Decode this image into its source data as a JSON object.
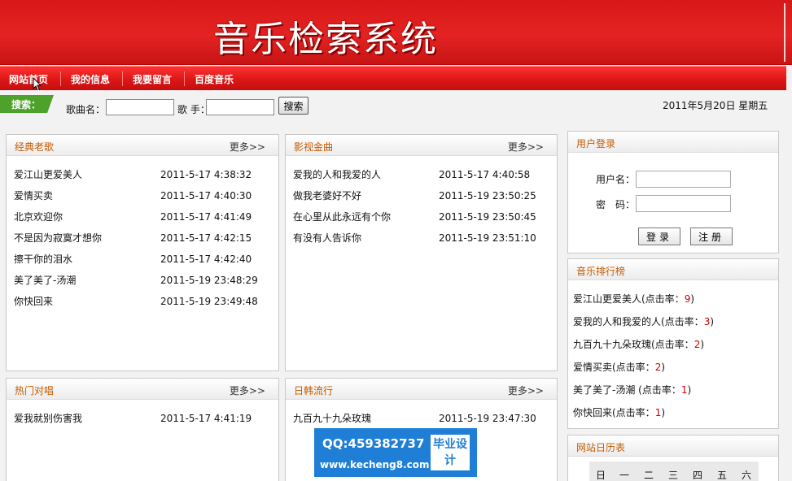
{
  "banner": {
    "title": "音乐检索系统"
  },
  "nav": [
    "网站首页",
    "我的信息",
    "我要留言",
    "百度音乐"
  ],
  "search": {
    "tag": "搜索：",
    "song_label": "歌曲名：",
    "song_value": "",
    "singer_label": "歌  手：",
    "singer_value": "",
    "button": "搜索",
    "date": "2011年5月20日  星期五"
  },
  "panels": {
    "classic": {
      "title": "经典老歌",
      "more": "更多>>",
      "rows": [
        {
          "name": "爱江山更爱美人",
          "time": "2011-5-17 4:38:32"
        },
        {
          "name": "爱情买卖",
          "time": "2011-5-17 4:40:30"
        },
        {
          "name": "北京欢迎你",
          "time": "2011-5-17 4:41:49"
        },
        {
          "name": "不是因为寂寞才想你",
          "time": "2011-5-17 4:42:15"
        },
        {
          "name": "擦干你的泪水",
          "time": "2011-5-17 4:42:40"
        },
        {
          "name": "美了美了-汤潮",
          "time": "2011-5-19 23:48:29"
        },
        {
          "name": "你快回来",
          "time": "2011-5-19 23:49:48"
        }
      ]
    },
    "film": {
      "title": "影视金曲",
      "more": "更多>>",
      "rows": [
        {
          "name": "爱我的人和我爱的人",
          "time": "2011-5-17 4:40:58"
        },
        {
          "name": "做我老婆好不好",
          "time": "2011-5-19 23:50:25"
        },
        {
          "name": "在心里从此永远有个你",
          "time": "2011-5-19 23:50:45"
        },
        {
          "name": "有没有人告诉你",
          "time": "2011-5-19 23:51:10"
        }
      ]
    },
    "duet": {
      "title": "热门对唱",
      "more": "更多>>",
      "rows": [
        {
          "name": "爱我就别伤害我",
          "time": "2011-5-17 4:41:19"
        }
      ]
    },
    "jk": {
      "title": "日韩流行",
      "more": "更多>>",
      "rows": [
        {
          "name": "九百九十九朵玫瑰",
          "time": "2011-5-19 23:47:30"
        }
      ]
    }
  },
  "login": {
    "title": "用户登录",
    "user_label": "用户名：",
    "pass_label": "密　码：",
    "login_btn": "登录",
    "register_btn": "注册"
  },
  "rank": {
    "title": "音乐排行榜",
    "items": [
      {
        "name": "爱江山更爱美人(点击率：",
        "count": "9",
        "end": ")"
      },
      {
        "name": "爱我的人和我爱的人(点击率：",
        "count": "3",
        "end": ")"
      },
      {
        "name": "九百九十九朵玫瑰(点击率：",
        "count": "2",
        "end": ")"
      },
      {
        "name": "爱情买卖(点击率：",
        "count": "2",
        "end": ")"
      },
      {
        "name": "美了美了-汤潮 (点击率：",
        "count": "1",
        "end": ")"
      },
      {
        "name": "你快回来(点击率：",
        "count": "1",
        "end": ")"
      }
    ]
  },
  "calendar": {
    "title": "网站日历表",
    "weekdays": [
      "日",
      "一",
      "二",
      "三",
      "四",
      "五",
      "六"
    ]
  },
  "watermark": {
    "qq": "QQ:459382737",
    "url": "www.kecheng8.com",
    "box": "毕业设计"
  },
  "colors": {
    "brand_red": "#e01818",
    "panel_title": "#c55a00",
    "search_tag": "#4ea12a"
  }
}
